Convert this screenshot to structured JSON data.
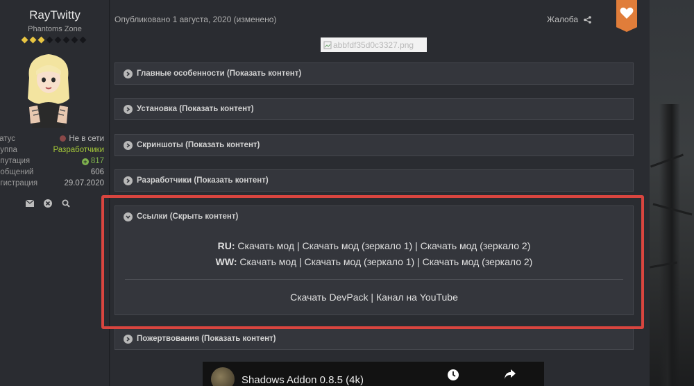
{
  "author": {
    "name": "RayTwitty",
    "group_title": "Phantoms Zone",
    "rank_pips_on": 3,
    "rank_pips_total": 8,
    "stats": [
      {
        "key": "Статус",
        "value": "Не в сети",
        "shown_key": "татус"
      },
      {
        "key": "Группа",
        "value": "Разработчики",
        "shown_key": "руппа"
      },
      {
        "key": "Репутация",
        "value": "817",
        "shown_key": "епутация"
      },
      {
        "key": "Сообщений",
        "value": "606",
        "shown_key": "ообщений"
      },
      {
        "key": "Регистрация",
        "value": "29.07.2020",
        "shown_key": "егистрация"
      }
    ],
    "actions": [
      "envelope-icon",
      "block-icon",
      "search-icon"
    ]
  },
  "post": {
    "published": "Опубликовано 1 августа, 2020 (изменено)",
    "report_label": "Жалоба",
    "broken_image_alt": "abbfdf35d0c3327.png",
    "spoilers": [
      {
        "label": "Главные особенности (Показать контент)",
        "open": false
      },
      {
        "label": "Установка (Показать контент)",
        "open": false
      },
      {
        "label": "Скриншоты (Показать контент)",
        "open": false
      },
      {
        "label": "Разработчики (Показать контент)",
        "open": false
      },
      {
        "label": "Ссылки (Скрыть контент)",
        "open": true
      },
      {
        "label": "Пожертвования (Показать контент)",
        "open": false
      }
    ],
    "links": {
      "ru_prefix": "RU:",
      "ww_prefix": "WW:",
      "download": "Скачать мод",
      "mirror1": "Скачать мод (зеркало 1)",
      "mirror2": "Скачать мод (зеркало 2)",
      "separator": "|",
      "devpack": "Скачать DevPack",
      "youtube": "Канал на YouTube"
    },
    "video_title": "Shadows Addon 0.8.5 (4k)"
  },
  "colors": {
    "highlight": "#d9453f",
    "accent": "#e07d3a",
    "reputation": "#7fb24e"
  }
}
